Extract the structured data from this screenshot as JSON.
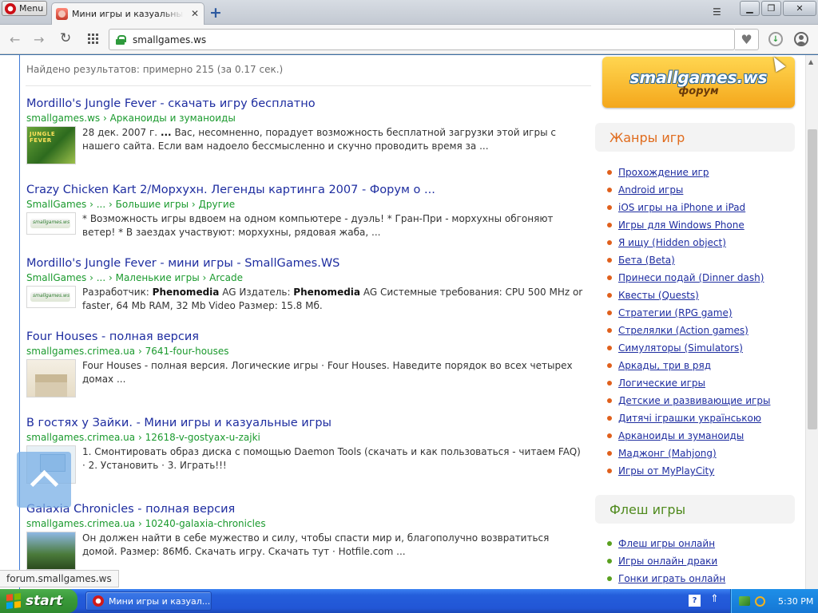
{
  "browser": {
    "menu_label": "Menu",
    "tab_title": "Мини игры и казуальные игры",
    "tab_close": "✕",
    "new_tab": "+",
    "tab_menu": "☰",
    "win_min": "▁",
    "win_max": "❐",
    "win_close": "✕",
    "address": "smallgames.ws",
    "back": "←",
    "forward": "→",
    "reload": "↻",
    "heart": "♥",
    "download": "↓"
  },
  "search": {
    "found_text": "Найдено результатов: примерно 215 (за 0.17 сек.)",
    "results": [
      {
        "title": "Mordillo's Jungle Fever - скачать игру бесплатно",
        "url": "smallgames.ws › Арканоиды и зуманоиды",
        "snippet_html": "28 дек. 2007 г. <b>...</b> Вас, несомненно, порадует возможность бесплатной загрузки этой игры с нашего сайта. Если вам надоело бессмысленно и скучно проводить время за ..."
      },
      {
        "title": "Crazy Chicken Kart 2/Морхухн. Легенды картинга 2007 - Форум о ...",
        "url": "SmallGames › ... › Большие игры › Другие",
        "snippet_html": "* Возможность игры вдвоем на одном компьютере - дуэль! * Гран-При - морхухны обгоняют ветер! * В заездах участвуют: морхухны, рядовая жаба, ..."
      },
      {
        "title": "Mordillo's Jungle Fever - мини игры - SmallGames.WS",
        "url": "SmallGames › ... › Маленькие игры › Arcade",
        "snippet_html": "Разработчик: <b>Phenomedia</b> AG Издатель: <b>Phenomedia</b> AG Системные требования: CPU 500 MHz or faster, 64 Mb RAM, 32 Mb Video Размер: 15.8 Мб."
      },
      {
        "title": "Four Houses - полная версия",
        "url": "smallgames.crimea.ua › 7641-four-houses",
        "snippet_html": "Four Houses - полная версия. Логические игры · Four Houses. Наведите порядок во всех четырех домах ..."
      },
      {
        "title": "В гостях у Зайки. - Мини игры и казуальные игры",
        "url": "smallgames.crimea.ua › 12618-v-gostyax-u-zajki",
        "snippet_html": "1. Смонтировать образ диска с помощью Daemon Tools (скачать и как пользоваться - читаем FAQ) · 2. Установить · 3. Играть!!!"
      },
      {
        "title": "Galaxia Chronicles - полная версия",
        "url": "smallgames.crimea.ua › 10240-galaxia-chronicles",
        "snippet_html": "Он должен найти в себе мужество и силу, чтобы спасти мир и, благополучно возвратиться домой. Размер: 86Мб. Скачать игру. Скачать тут · Hotfile.com ..."
      }
    ]
  },
  "sidebar": {
    "banner_logo": "smallgames.ws",
    "banner_sub": "форум",
    "genres_title": "Жанры игр",
    "genres": [
      "Прохождение игр",
      "Android игры",
      "iOS игры на iPhone и iPad",
      "Игры для Windows Phone",
      "Я ищу (Hidden object)",
      "Бета (Beta)",
      "Принеси подай (Dinner dash)",
      "Квесты (Quests)",
      "Стратегии (RPG game)",
      "Стрелялки (Action games)",
      "Симуляторы (Simulators)",
      "Аркады, три в ряд",
      "Логические игры",
      "Детские и развивающие игры",
      "Дитячі іграшки українською",
      "Арканоиды и зуманоиды",
      "Маджонг (Mahjong)",
      "Игры от MyPlayCity"
    ],
    "flash_title": "Флеш игры",
    "flash": [
      "Флеш игры онлайн",
      "Игры онлайн драки",
      "Гонки играть онлайн"
    ]
  },
  "status_url": "forum.smallgames.ws",
  "taskbar": {
    "start_label": "start",
    "task_label": "Мини игры и казуал...",
    "help": "?",
    "clock": "5:30 PM"
  }
}
